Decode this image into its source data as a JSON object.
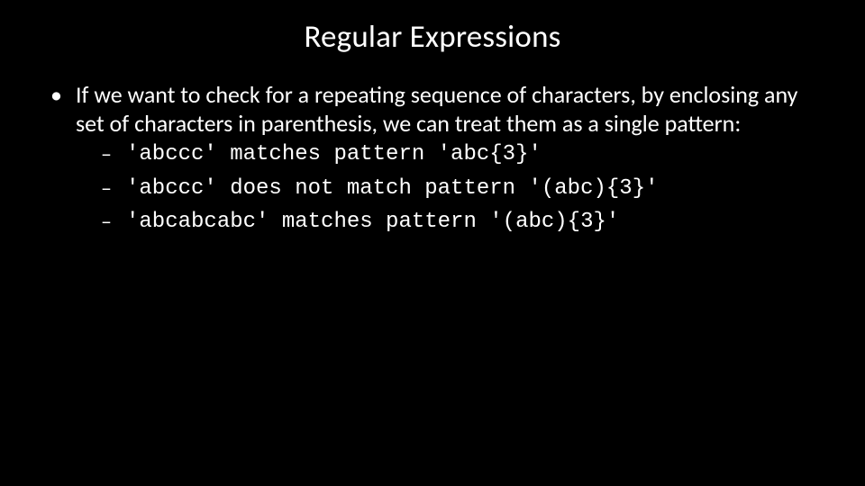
{
  "slide": {
    "title": "Regular Expressions",
    "bullet": "If we want to check for a repeating sequence of characters, by enclosing any set of characters in parenthesis,  we can treat them as a single pattern:",
    "examples": [
      "'abccc' matches pattern 'abc{3}'",
      "'abccc' does not match pattern '(abc){3}'",
      "'abcabcabc' matches pattern '(abc){3}'"
    ]
  }
}
